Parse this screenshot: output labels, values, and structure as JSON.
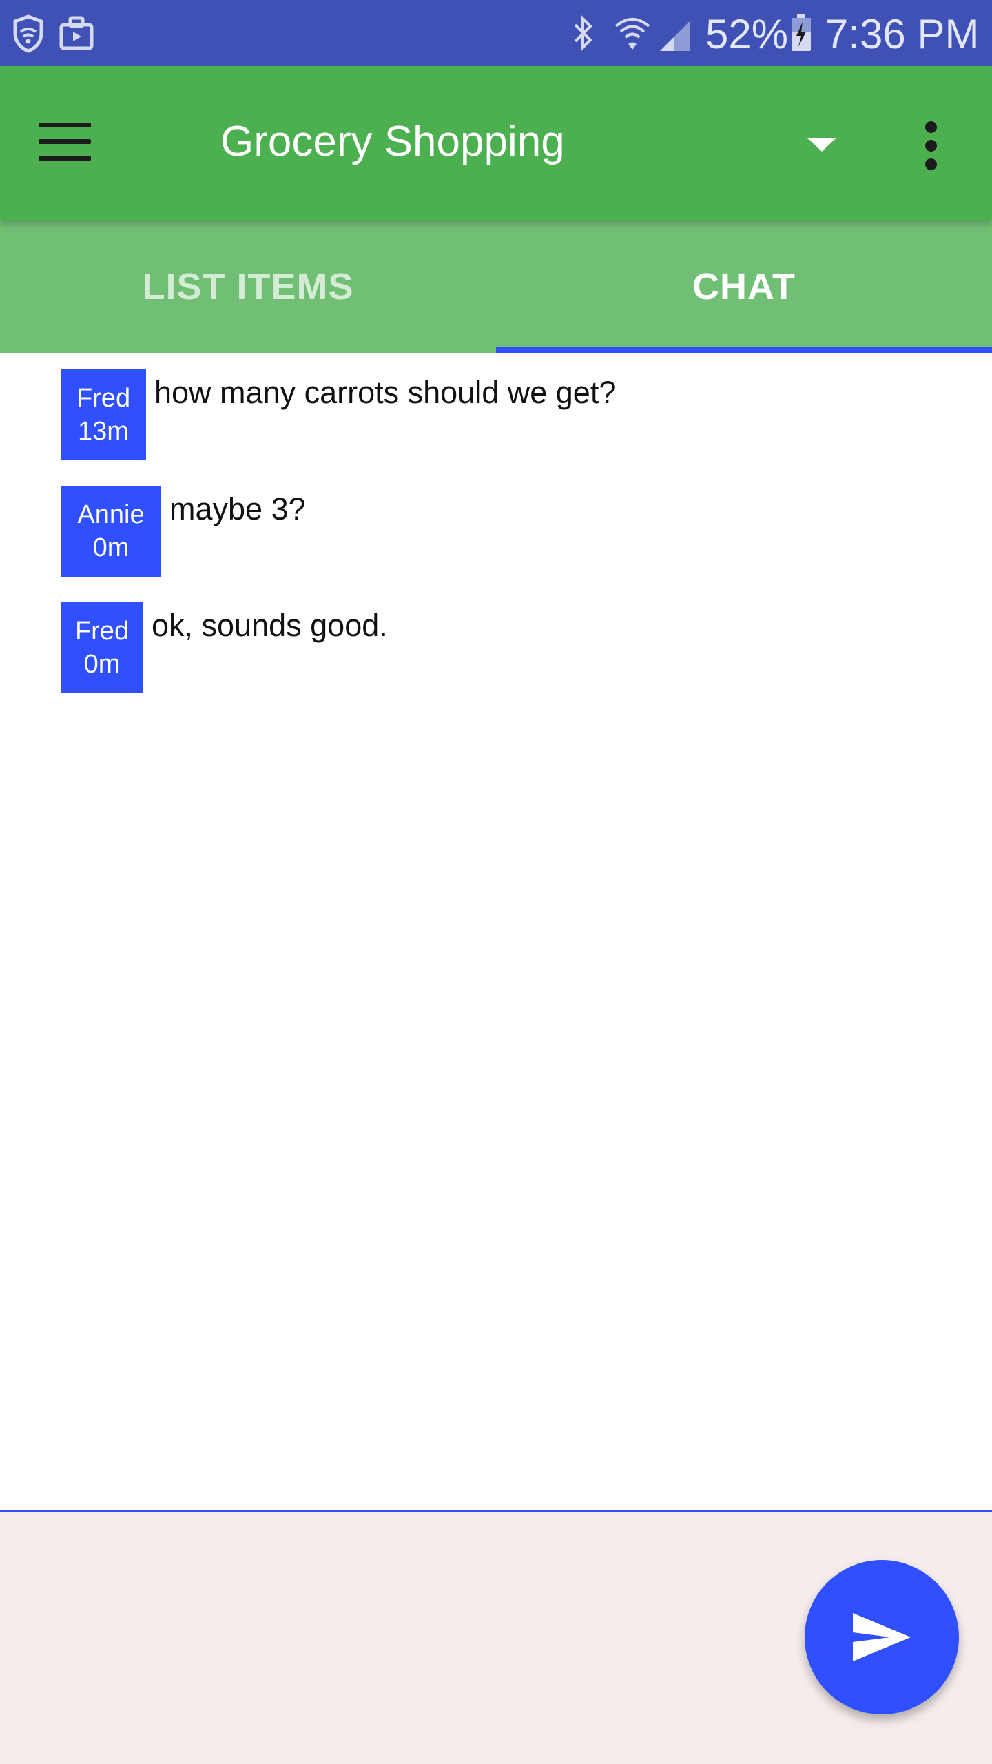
{
  "status_bar": {
    "battery_percent": "52%",
    "time": "7:36 PM",
    "icons": [
      "shield-wifi-icon",
      "briefcase-icon",
      "bluetooth-icon",
      "wifi-icon",
      "signal-icon",
      "battery-charging-icon"
    ]
  },
  "toolbar": {
    "title": "Grocery Shopping",
    "menu_icon": "hamburger-menu-icon",
    "dropdown_icon": "dropdown-arrow-icon",
    "overflow_icon": "more-vert-icon"
  },
  "tabs": [
    {
      "label": "LIST ITEMS",
      "selected": false
    },
    {
      "label": "CHAT",
      "selected": true
    }
  ],
  "messages": [
    {
      "author": "Fred",
      "age": "13m",
      "text": "how many carrots should we get?"
    },
    {
      "author": "Annie",
      "age": "0m",
      "text": "maybe 3?"
    },
    {
      "author": "Fred",
      "age": "0m",
      "text": "ok, sounds good."
    }
  ],
  "composer": {
    "value": "",
    "send_icon": "send-icon"
  },
  "colors": {
    "status_bar": "#3f51b5",
    "toolbar": "#4caf50",
    "tab_bar": "#71bf74",
    "accent": "#304ffe",
    "composer_background": "#f5ecec"
  }
}
